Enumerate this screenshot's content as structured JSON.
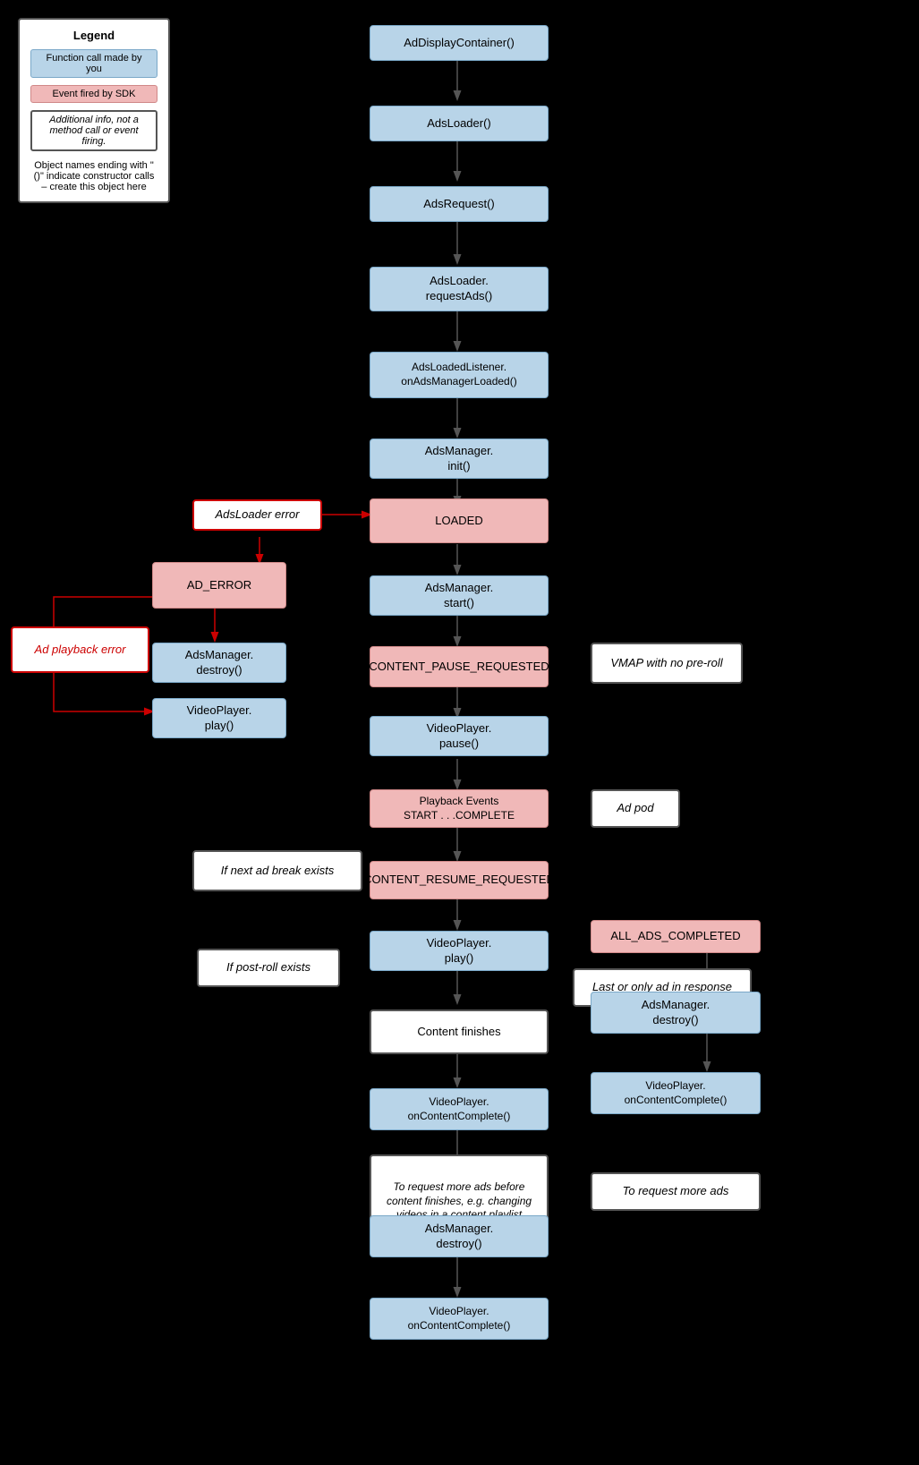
{
  "legend": {
    "title": "Legend",
    "function_call_label": "Function call made by you",
    "event_fired_label": "Event fired by SDK",
    "additional_info_label": "Additional info, not a method call or event firing.",
    "note": "Object names ending with \"()\" indicate constructor calls – create this object here"
  },
  "boxes": {
    "ad_display_container": "AdDisplayContainer()",
    "ads_loader": "AdsLoader()",
    "ads_request": "AdsRequest()",
    "ads_loader_request": "AdsLoader.\nrequestAds()",
    "ads_loaded_listener": "AdsLoadedListener.\nonAdsManagerLoaded()",
    "ads_manager_init": "AdsManager.\ninit()",
    "adsloader_error": "AdsLoader error",
    "loaded": "LOADED",
    "ad_error": "AD_ERROR",
    "ads_manager_start": "AdsManager.\nstart()",
    "ad_playback_error": "Ad playback error",
    "ads_manager_destroy_1": "AdsManager.\ndestroy()",
    "content_pause_requested": "CONTENT_PAUSE_REQUESTED",
    "vmap_no_preroll": "VMAP with no pre-roll",
    "video_player_play_1": "VideoPlayer.\nplay()",
    "video_player_pause": "VideoPlayer.\npause()",
    "playback_events": "Playback Events\nSTART . . .COMPLETE",
    "ad_pod": "Ad pod",
    "if_next_ad_break": "If next ad break exists",
    "content_resume_requested": "CONTENT_RESUME_REQUESTED",
    "video_player_play_2": "VideoPlayer.\nplay()",
    "if_post_roll": "If post-roll exists",
    "last_or_only_ad": "Last or only ad in response",
    "content_finishes": "Content finishes",
    "all_ads_completed": "ALL_ADS_COMPLETED",
    "video_player_on_content_complete_1": "VideoPlayer.\nonContentComplete()",
    "ads_manager_destroy_2": "AdsManager.\ndestroy()",
    "video_player_on_content_complete_2": "VideoPlayer.\nonContentComplete()",
    "to_request_more_ads": "To request more ads before content finishes, e.g. changing videos in a content playlist",
    "to_request_more_ads_label": "To request more ads",
    "ads_manager_destroy_3": "AdsManager.\ndestroy()",
    "video_player_on_content_complete_3": "VideoPlayer.\nonContentComplete()"
  }
}
